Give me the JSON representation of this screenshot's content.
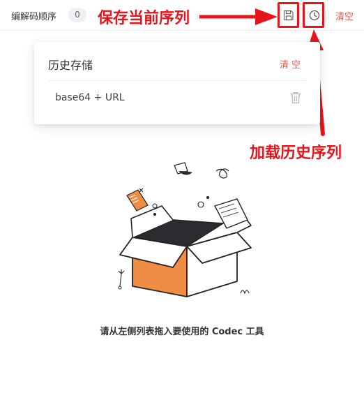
{
  "topbar": {
    "title": "编解码顺序",
    "count": "0",
    "clear_label": "清空",
    "save_icon": "save-icon",
    "history_icon": "clock-icon"
  },
  "annotations": {
    "save_sequence": "保存当前序列",
    "load_history": "加载历史序列",
    "highlight_color": "#e5151b"
  },
  "history_panel": {
    "title": "历史存储",
    "clear_label": "清空",
    "items": [
      {
        "label": "base64 + URL",
        "icon": "trash-icon"
      }
    ]
  },
  "empty_state": {
    "message": "请从左侧列表拖入要使用的 Codec 工具",
    "illustration": "open-box-illustration"
  },
  "colors": {
    "accent_red": "#e2564f",
    "box_orange": "#f08c44"
  }
}
